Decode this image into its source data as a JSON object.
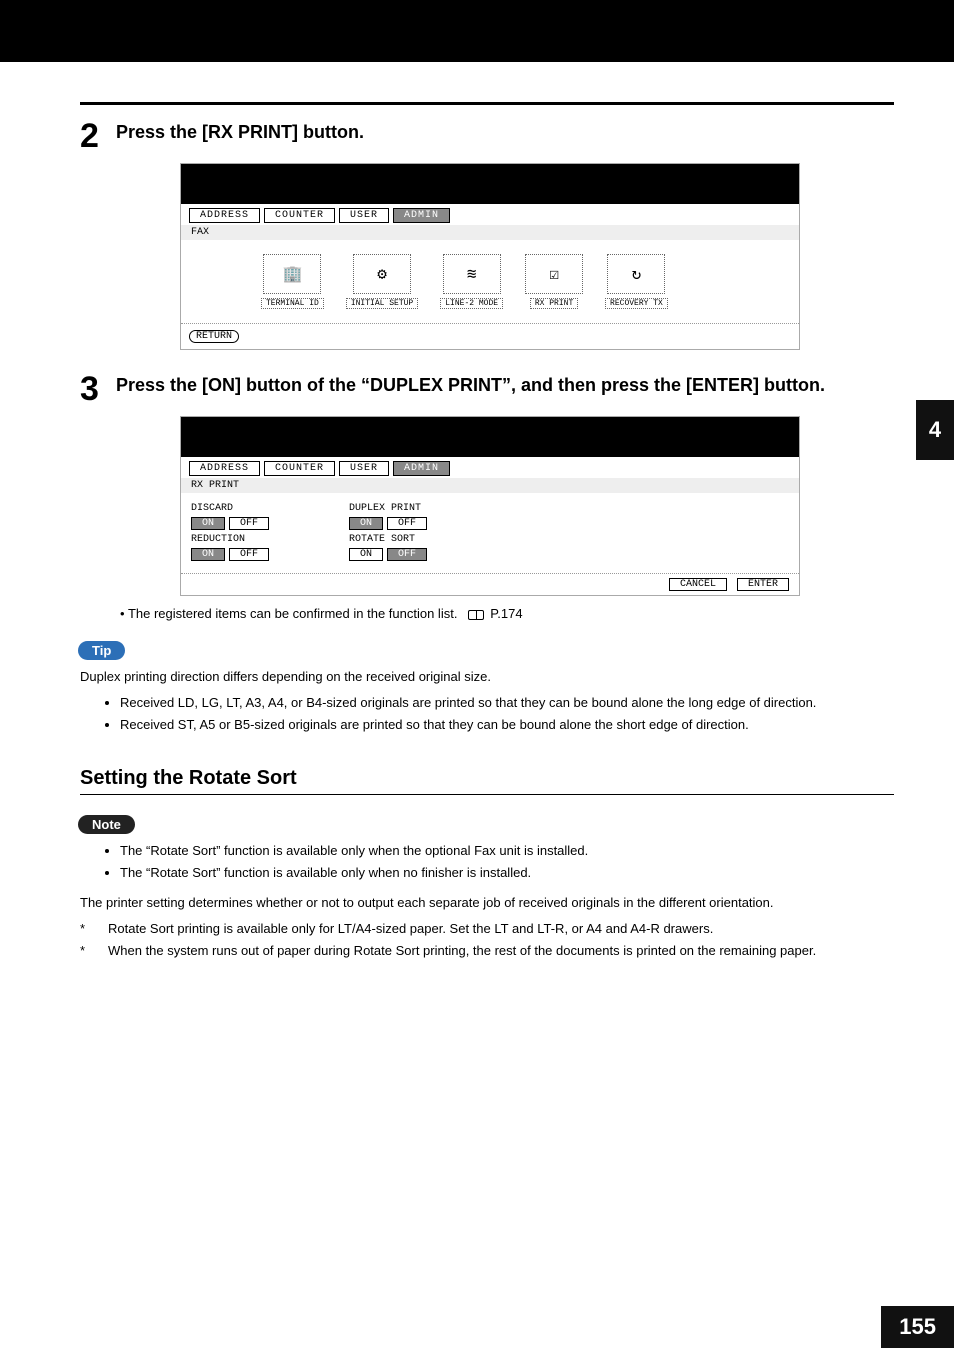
{
  "section_number": "4",
  "page_number": "155",
  "steps": {
    "s2": {
      "num": "2",
      "text": "Press the [RX PRINT] button."
    },
    "s3": {
      "num": "3",
      "text": "Press the [ON] button of the “DUPLEX PRINT”, and then press the [ENTER] button."
    }
  },
  "panel1": {
    "tabs": {
      "address": "ADDRESS",
      "counter": "COUNTER",
      "user": "USER",
      "admin": "ADMIN"
    },
    "sub": "FAX",
    "icons": {
      "terminal": "TERMINAL ID",
      "initial": "INITIAL SETUP",
      "line2": "LINE-2 MODE",
      "rxprint": "RX PRINT",
      "recovery": "RECOVERY TX"
    },
    "return_btn": "RETURN"
  },
  "panel2": {
    "sub": "RX PRINT",
    "groups": {
      "discard": "DISCARD",
      "reduction": "REDUCTION",
      "duplex": "DUPLEX PRINT",
      "rotate": "ROTATE SORT"
    },
    "on": "ON",
    "off": "OFF",
    "cancel": "CANCEL",
    "enter": "ENTER"
  },
  "note_line": {
    "pre": "The registered items can be confirmed in the function list.",
    "ref": "P.174"
  },
  "tip_label": "Tip",
  "tip_body": "Duplex printing direction differs depending on the received original size.",
  "tip_bullets": [
    "Received LD, LG, LT, A3, A4, or B4-sized originals are printed so that they can be bound alone the long edge of direction.",
    "Received ST, A5 or B5-sized originals are printed so that they can be bound alone the short edge of direction."
  ],
  "subheading": "Setting the Rotate Sort",
  "note_label": "Note",
  "note_bullets": [
    "The “Rotate Sort” function is available only when the optional Fax unit is installed.",
    "The “Rotate Sort” function is available only when no finisher is installed."
  ],
  "rotate_body": "The printer setting determines whether or not to output each separate job of received originals in the different orientation.",
  "rotate_star": [
    "Rotate Sort printing is available only for LT/A4-sized paper. Set the LT and LT-R, or A4 and A4-R drawers.",
    "When the system runs out of paper during Rotate Sort printing, the rest of the documents is printed on the remaining paper."
  ]
}
